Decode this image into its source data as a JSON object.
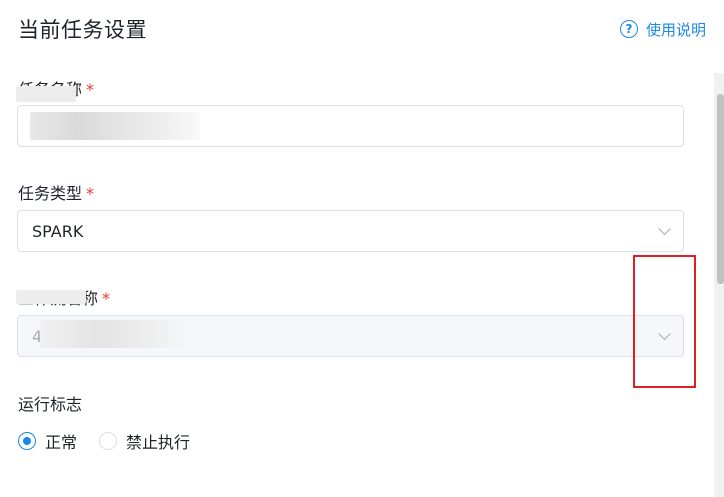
{
  "header": {
    "title": "当前任务设置",
    "help_icon": "question-circle-icon",
    "help_label": "使用说明"
  },
  "task_name": {
    "label": "任务名称",
    "required_mark": "*",
    "value": "t"
  },
  "task_type": {
    "label": "任务类型",
    "required_mark": "*",
    "value": "SPARK"
  },
  "workflow_name": {
    "label": "工作流名称",
    "required_mark": "*",
    "value": "4"
  },
  "run_flag": {
    "label": "运行标志",
    "options": [
      {
        "label": "正常",
        "checked": true
      },
      {
        "label": "禁止执行",
        "checked": false
      }
    ]
  },
  "colors": {
    "accent": "#1e88e5",
    "required": "#e53935",
    "highlight": "#e02020"
  }
}
